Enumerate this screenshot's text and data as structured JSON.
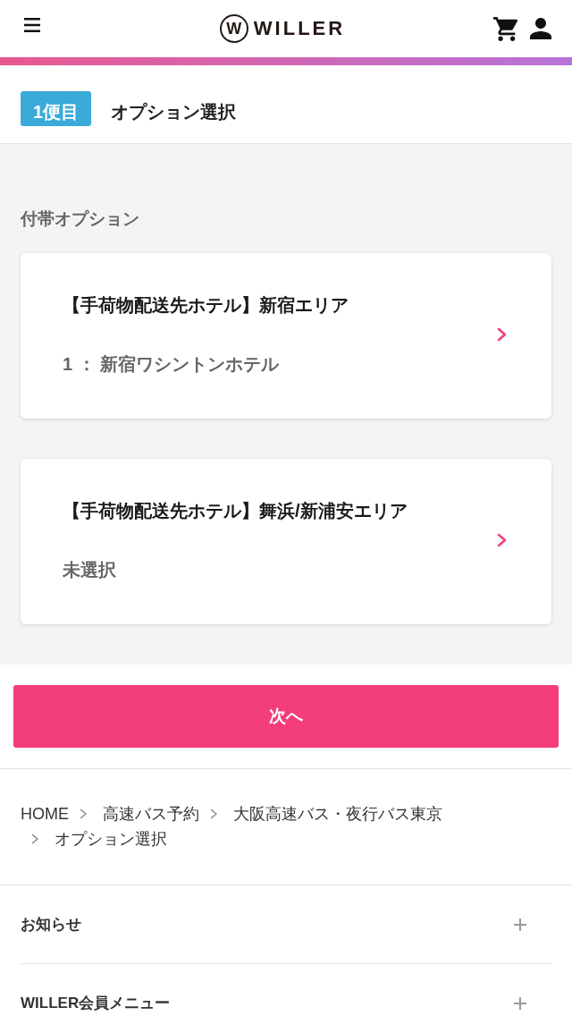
{
  "header": {
    "logo": {
      "mark": "W",
      "name": "WILLER"
    }
  },
  "trip": {
    "badge": "1便目",
    "title": "オプション選択"
  },
  "options": {
    "heading": "付帯オプション",
    "items": [
      {
        "title": "【手荷物配送先ホテル】新宿エリア",
        "value": "1 ： 新宿ワシントンホテル"
      },
      {
        "title": "【手荷物配送先ホテル】舞浜/新浦安エリア",
        "value": "未選択"
      }
    ]
  },
  "next_button": "次へ",
  "breadcrumb": [
    {
      "label": "HOME"
    },
    {
      "label": "高速バス予約"
    },
    {
      "label": "大阪高速バス・夜行バス東京"
    },
    {
      "label": "オプション選択"
    }
  ],
  "footer_menu": [
    {
      "label": "お知らせ",
      "expanded": false
    },
    {
      "label": "WILLER会員メニュー",
      "expanded": false
    }
  ]
}
